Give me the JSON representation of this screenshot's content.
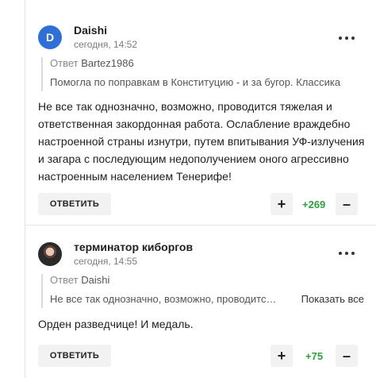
{
  "comments": [
    {
      "avatar_letter": "D",
      "author": "Daishi",
      "time": "сегодня, 14:52",
      "reply_label": "Ответ",
      "reply_to": "Bartez1986",
      "quote": "Помогла по поправкам в Конституцию - и за бугор. Классика",
      "text": "Не все так однозначно, возможно, проводится тяжелая и ответственная закордонная работа. Ослабление враждебно настроенной страны изнутри, путем впитывания УФ-излучения и загара с последующим недополучением оного агрессивно настроенным населением Тенерифе!",
      "reply_button": "ОТВЕТИТЬ",
      "plus": "+",
      "minus": "–",
      "score": "+269"
    },
    {
      "author": "терминатор киборгов",
      "time": "сегодня, 14:55",
      "reply_label": "Ответ",
      "reply_to": "Daishi",
      "quote": "Не все так однозначно, возможно, проводитс…",
      "show_all": "Показать все",
      "text": "Орден разведчице! И медаль.",
      "reply_button": "ОТВЕТИТЬ",
      "plus": "+",
      "minus": "–",
      "score": "+75"
    }
  ],
  "colors": {
    "avatar_bg": "#2f6fd6",
    "score_positive": "#2e9e3e"
  },
  "icons": {
    "more": "more-dots-icon",
    "avatar_photo": "user-avatar-photo"
  }
}
